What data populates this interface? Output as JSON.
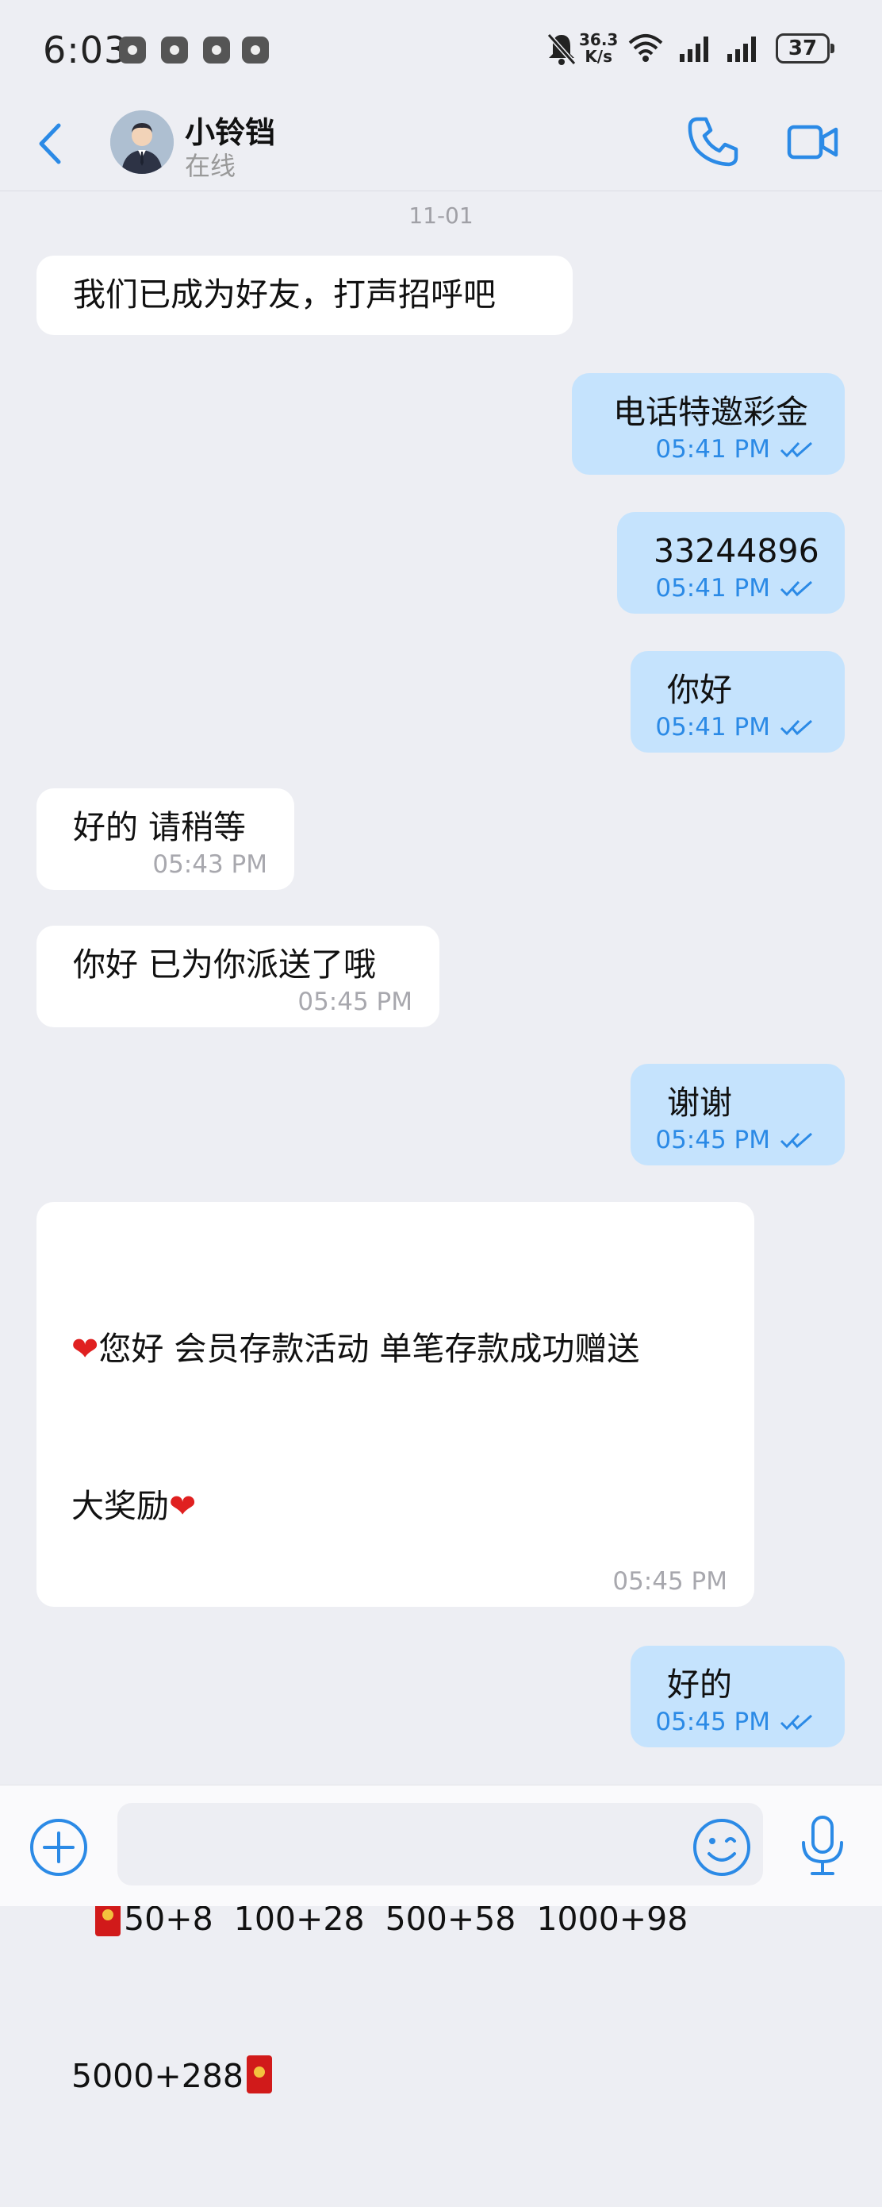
{
  "status_bar": {
    "time": "6:03",
    "net_speed_value": "36.3",
    "net_speed_unit": "K/s",
    "battery": "37",
    "icons": [
      "notification-icon",
      "notification-icon",
      "notification-icon",
      "notification-icon",
      "mute-icon",
      "wifi-icon",
      "signal-icon",
      "signal-icon",
      "battery-icon"
    ]
  },
  "header": {
    "contact_name": "小铃铛",
    "contact_status": "在线",
    "icons": [
      "back-icon",
      "phone-icon",
      "video-call-icon"
    ]
  },
  "date_separator": "11-01",
  "messages": [
    {
      "dir": "in",
      "text": "我们已成为好友，打声招呼吧"
    },
    {
      "dir": "out",
      "text": "电话特邀彩金",
      "time": "05:41 PM"
    },
    {
      "dir": "out",
      "text": "33244896",
      "time": "05:41 PM"
    },
    {
      "dir": "out",
      "text": "你好",
      "time": "05:41 PM"
    },
    {
      "dir": "in",
      "text": "好的 请稍等",
      "time": "05:43 PM"
    },
    {
      "dir": "in",
      "text": "你好 已为你派送了哦",
      "time": "05:45 PM"
    },
    {
      "dir": "out",
      "text": "谢谢",
      "time": "05:45 PM"
    },
    {
      "dir": "in",
      "line1": "您好 会员存款活动 单笔存款成功赠送",
      "line2": "大奖励",
      "line3": "50+8  100+28  500+58  1000+98",
      "line4": "5000+288",
      "time": "05:45 PM"
    },
    {
      "dir": "out",
      "text": "好的",
      "time": "05:45 PM"
    }
  ],
  "input_bar": {
    "placeholder": "",
    "icons": [
      "add-icon",
      "emoji-icon",
      "microphone-icon"
    ]
  },
  "colors": {
    "accent": "#2b8ae6",
    "outgoing_bubble": "#c5e3fd",
    "incoming_bubble": "#ffffff",
    "background": "#edeef3"
  }
}
